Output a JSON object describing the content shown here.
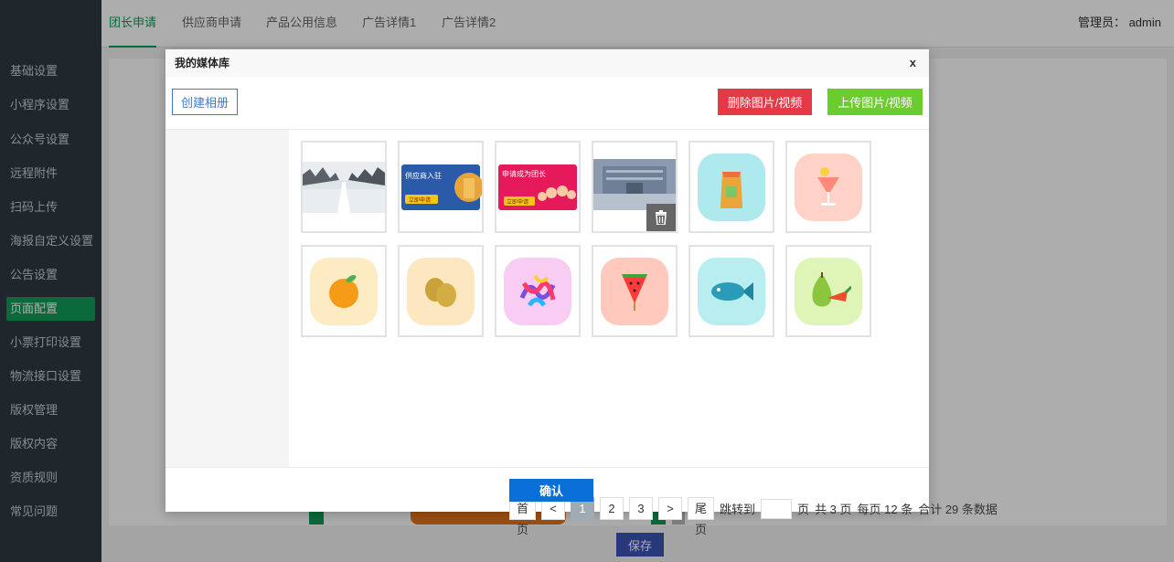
{
  "sidebar": {
    "items": [
      {
        "label": "基础设置"
      },
      {
        "label": "小程序设置"
      },
      {
        "label": "公众号设置"
      },
      {
        "label": "远程附件"
      },
      {
        "label": "扫码上传"
      },
      {
        "label": "海报自定义设置"
      },
      {
        "label": "公告设置"
      },
      {
        "label": "页面配置",
        "active": true
      },
      {
        "label": "小票打印设置"
      },
      {
        "label": "物流接口设置"
      },
      {
        "label": "版权管理"
      },
      {
        "label": "版权内容"
      },
      {
        "label": "资质规则"
      },
      {
        "label": "常见问题"
      }
    ]
  },
  "topbar": {
    "tabs": [
      {
        "label": "团长申请",
        "active": true
      },
      {
        "label": "供应商申请"
      },
      {
        "label": "产品公用信息"
      },
      {
        "label": "广告详情1"
      },
      {
        "label": "广告详情2"
      }
    ],
    "admin_label": "管理员： admin"
  },
  "page": {
    "save_label": "保存"
  },
  "modal": {
    "title": "我的媒体库",
    "close_label": "x",
    "create_album_label": "创建相册",
    "delete_label": "删除图片/视频",
    "upload_label": "上传图片/视频",
    "confirm_label": "确认",
    "thumbnails": [
      {
        "kind": "photo",
        "icon": "snowy-road-photo"
      },
      {
        "kind": "banner",
        "icon": "supplier-banner",
        "text": "供应商入驻",
        "sub": "立即申请"
      },
      {
        "kind": "banner",
        "icon": "leader-banner",
        "text": "申请成为团长",
        "sub": "立即申请"
      },
      {
        "kind": "photo",
        "icon": "building-photo",
        "selected": true
      },
      {
        "kind": "tile",
        "icon": "snack-bag-icon"
      },
      {
        "kind": "tile",
        "icon": "drink-cup-icon"
      },
      {
        "kind": "tile",
        "icon": "orange-icon"
      },
      {
        "kind": "tile",
        "icon": "kiwi-icon"
      },
      {
        "kind": "tile",
        "icon": "candy-icon"
      },
      {
        "kind": "tile",
        "icon": "watermelon-icon"
      },
      {
        "kind": "tile",
        "icon": "fish-icon"
      },
      {
        "kind": "tile",
        "icon": "pear-vegetable-icon"
      }
    ],
    "pagination": {
      "first": "首页",
      "prev": "<",
      "pages": [
        "1",
        "2",
        "3"
      ],
      "current": "1",
      "next": ">",
      "last": "尾页",
      "jump_label": "跳转到",
      "jump_value": "",
      "page_unit": "页",
      "total_pages": "共 3 页",
      "per_page": "每页 12 条",
      "total": "合计 29 条数据"
    }
  },
  "colors": {
    "sidebar_bg": "#2f3a42",
    "active_green": "#0f9d58",
    "delete_red": "#e63946",
    "upload_green": "#6bcb2f",
    "confirm_blue": "#0a6fd8"
  }
}
